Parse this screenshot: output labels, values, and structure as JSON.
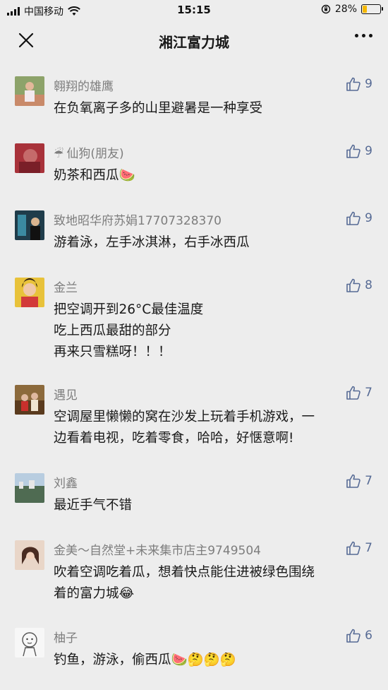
{
  "status": {
    "carrier": "中国移动",
    "time": "15:15",
    "battery": "28%",
    "battery_level": 0.28
  },
  "nav": {
    "title": "湘江富力城"
  },
  "comments": [
    {
      "name": "翱翔的雄鹰",
      "text": [
        "在负氧离子多的山里避暑是一种享受"
      ],
      "likes": "9"
    },
    {
      "name": "仙狗(朋友)",
      "name_prefix_icon": "umbrella-emoji",
      "text": [
        "奶茶和西瓜🍉"
      ],
      "likes": "9"
    },
    {
      "name": "致地昭华府苏娟17707328370",
      "text": [
        "游着泳，左手冰淇淋，右手冰西瓜"
      ],
      "likes": "9"
    },
    {
      "name": "金兰",
      "text": [
        "把空调开到26°C最佳温度",
        "吃上西瓜最甜的部分",
        "再来只雪糕呀！！！"
      ],
      "likes": "8"
    },
    {
      "name": "遇见",
      "text": [
        "空调屋里懒懒的窝在沙发上玩着手机游戏，一",
        "边看着电视，吃着零食，哈哈，好惬意啊!"
      ],
      "likes": "7"
    },
    {
      "name": "刘鑫",
      "text": [
        "最近手气不错"
      ],
      "likes": "7"
    },
    {
      "name": "金美～自然堂+未来集市店主9749504",
      "text": [
        "吹着空调吃着瓜，想着快点能住进被绿色围绕",
        "着的富力城😂"
      ],
      "likes": "7"
    },
    {
      "name": "柚子",
      "text": [
        "钓鱼，游泳，偷西瓜🍉🤔🤔🤔"
      ],
      "likes": "6"
    }
  ],
  "colors": {
    "background": "#ededed",
    "nickname": "#7d7d7d",
    "like": "#576b95",
    "battery_fill": "#f5b800"
  }
}
